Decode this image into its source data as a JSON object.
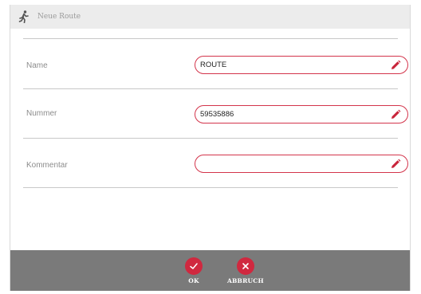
{
  "header": {
    "title": "Neue Route",
    "icon": "running-person-icon"
  },
  "form": {
    "name": {
      "label": "Name",
      "value": "ROUTE"
    },
    "nummer": {
      "label": "Nummer",
      "value": "59535886"
    },
    "kommentar": {
      "label": "Kommentar",
      "value": ""
    }
  },
  "footer": {
    "ok_label": "OK",
    "cancel_label": "ABBRUCH"
  },
  "colors": {
    "accent": "#d0283f",
    "footer_bg": "#7a7a7a",
    "header_bg": "#ececec"
  }
}
